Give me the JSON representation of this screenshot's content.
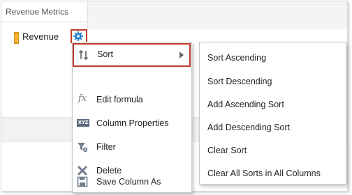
{
  "table": {
    "title": "Revenue Metrics",
    "column_label": "Revenue"
  },
  "menu": {
    "items": [
      {
        "label": "Sort",
        "icon": "sort-icon"
      },
      {
        "label": "Edit formula",
        "icon": "fx-icon"
      },
      {
        "label": "Column Properties",
        "icon": "xyz-icon"
      },
      {
        "label": "Filter",
        "icon": "filter-icon"
      },
      {
        "label": "Delete",
        "icon": "delete-x-icon"
      },
      {
        "label": "Save Column As",
        "icon": "save-icon"
      }
    ],
    "fx_glyph": "fx",
    "xyz_glyph": "XYZ"
  },
  "sort_submenu": {
    "items": [
      {
        "label": "Sort Ascending"
      },
      {
        "label": "Sort Descending"
      },
      {
        "label": "Add Ascending Sort"
      },
      {
        "label": "Add Descending Sort"
      },
      {
        "label": "Clear Sort"
      },
      {
        "label": "Clear All Sorts in All Columns"
      }
    ]
  },
  "colors": {
    "highlight_border": "#c0392b",
    "gear_blue": "#1f7fd1",
    "column_icon": "#f0a81c"
  }
}
